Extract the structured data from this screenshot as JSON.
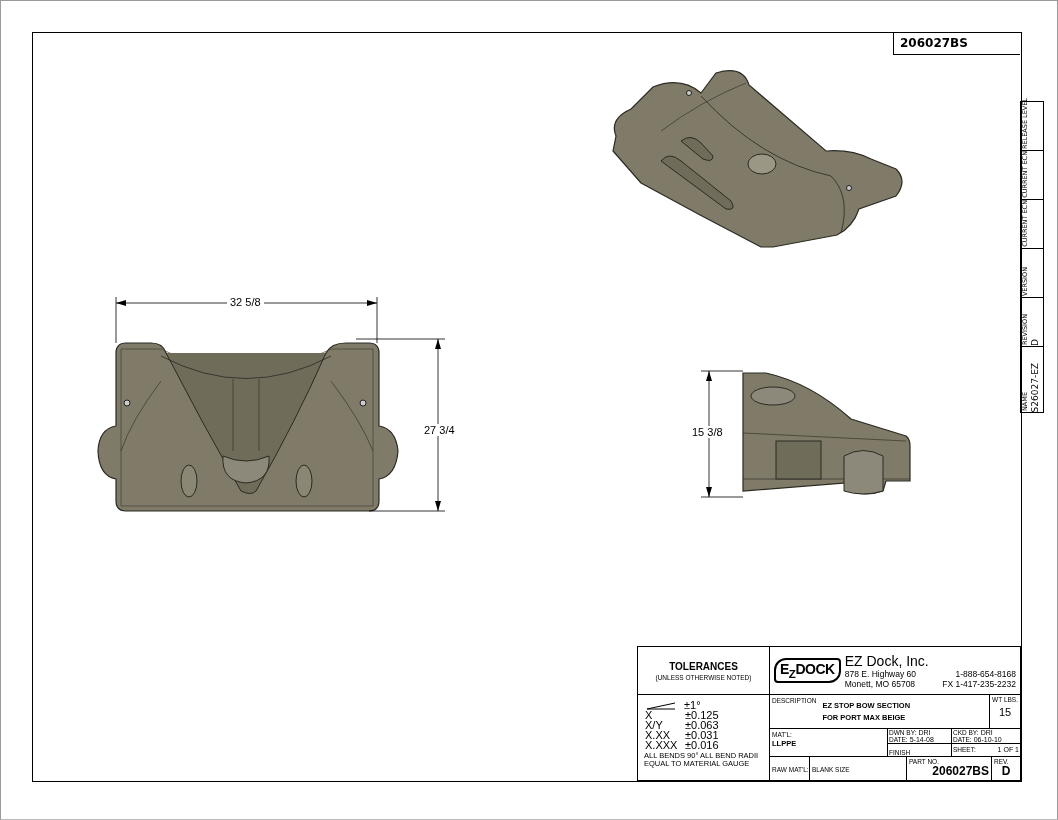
{
  "part_label": "206027BS",
  "side_tabs": [
    {
      "label": "RELEASE LEVEL"
    },
    {
      "label": "CURRENT ECN"
    },
    {
      "label": "CURRENT ECN"
    },
    {
      "label": "VERSION"
    },
    {
      "label": "REVISION",
      "value": "D"
    },
    {
      "label": "NAME",
      "value": "S26027-EZ"
    }
  ],
  "front_view": {
    "width_dim": "32 5/8",
    "height_dim": "27 3/4"
  },
  "side_view": {
    "height_dim": "15 3/8"
  },
  "title_block": {
    "tolerances": {
      "heading": "TOLERANCES",
      "note": "(UNLESS OTHERWISE NOTED)",
      "rows": [
        {
          "kind": "angle",
          "value": "±1°"
        },
        {
          "kind": "text",
          "label": "X",
          "value": "±0.125"
        },
        {
          "kind": "text",
          "label": "X/Y",
          "value": "±0.063"
        },
        {
          "kind": "text",
          "label": "X.XX",
          "value": "±0.031"
        },
        {
          "kind": "text",
          "label": "X.XXX",
          "value": "±0.016"
        }
      ],
      "bends_note": "ALL BENDS 90°   ALL BEND RADII EQUAL TO MATERIAL GAUGE"
    },
    "company": {
      "logo": "E$_{Z}$DOCK",
      "name": "EZ Dock, Inc.",
      "address": [
        "878 E. Highway 60",
        "Monett, MO 65708"
      ],
      "phones": [
        "1-888-654-8168",
        "FX  1-417-235-2232"
      ]
    },
    "description": {
      "label": "DESCRIPTION",
      "lines": [
        "EZ STOP BOW SECTION",
        "FOR PORT MAX BEIGE"
      ]
    },
    "weight": {
      "label": "WT",
      "unit": "LBS.",
      "value": "15"
    },
    "material": {
      "label": "MAT'L:",
      "value": "LLPPE"
    },
    "drawn": {
      "by_label": "DWN BY:",
      "by": "DRI",
      "date_label": "DATE:",
      "date": "5-14-08"
    },
    "checked": {
      "by_label": "CKD BY:",
      "by": "DRI",
      "date_label": "DATE:",
      "date": "06-10-10"
    },
    "finish": {
      "label": "FINISH"
    },
    "sheet": {
      "label": "SHEET:",
      "value": "1 OF 1"
    },
    "raw_material": {
      "label": "RAW MAT'L:"
    },
    "blank_size": {
      "label": "BLANK SIZE"
    },
    "part_no": {
      "label": "PART NO.",
      "value": "206027BS"
    },
    "revision": {
      "label": "REV.",
      "value": "D"
    }
  }
}
